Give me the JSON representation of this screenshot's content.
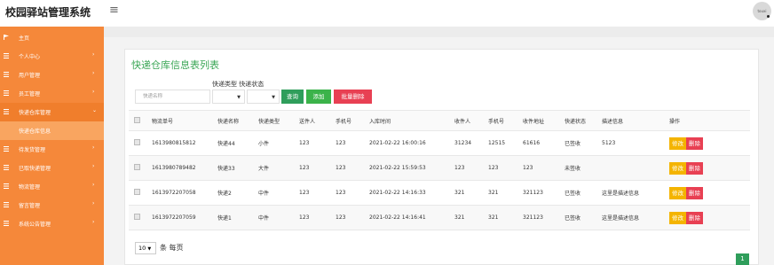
{
  "app": {
    "title": "校园驿站管理系统",
    "menu_icon": "hamburger-icon",
    "avatar_text": "touxi"
  },
  "sidebar": {
    "items": [
      {
        "label": "主页",
        "icon": "flag-icon",
        "arrow": ""
      },
      {
        "label": "个人中心",
        "icon": "grid-icon",
        "arrow": "›"
      },
      {
        "label": "用户管理",
        "icon": "grid-icon",
        "arrow": "›"
      },
      {
        "label": "员工管理",
        "icon": "grid-icon",
        "arrow": "›"
      },
      {
        "label": "快递仓库管理",
        "icon": "grid-icon",
        "arrow": "⌄"
      },
      {
        "label": "快递仓库信息",
        "icon": "",
        "arrow": ""
      },
      {
        "label": "待发货管理",
        "icon": "grid-icon",
        "arrow": "›"
      },
      {
        "label": "已取快递管理",
        "icon": "grid-icon",
        "arrow": "›"
      },
      {
        "label": "物流管理",
        "icon": "grid-icon",
        "arrow": "›"
      },
      {
        "label": "留言管理",
        "icon": "grid-icon",
        "arrow": "›"
      },
      {
        "label": "系统公告管理",
        "icon": "grid-icon",
        "arrow": "›"
      }
    ]
  },
  "main": {
    "title": "快递仓库信息表列表",
    "filters": {
      "label_type": "快递类型",
      "label_status": "快递状态",
      "search_placeholder": "快递名称",
      "type_value": "",
      "status_value": "",
      "query_label": "查询",
      "add_label": "添加",
      "batch_delete_label": "批量删除"
    },
    "table": {
      "headers": [
        "物流单号",
        "快递名称",
        "快递类型",
        "送件人",
        "手机号",
        "入库时间",
        "收件人",
        "手机号",
        "收件地址",
        "快递状态",
        "描述信息",
        "操作"
      ],
      "rows": [
        [
          "1613980815812",
          "快递44",
          "小件",
          "123",
          "123",
          "2021-02-22 16:00:16",
          "31234",
          "12515",
          "61616",
          "已签收",
          "5123"
        ],
        [
          "1613980789482",
          "快递33",
          "大件",
          "123",
          "123",
          "2021-02-22 15:59:53",
          "123",
          "123",
          "123",
          "未签收",
          ""
        ],
        [
          "1613972207058",
          "快递2",
          "中件",
          "123",
          "123",
          "2021-02-22 14:16:33",
          "321",
          "321",
          "321123",
          "已签收",
          "这里是描述信息"
        ],
        [
          "1613972207059",
          "快递1",
          "中件",
          "123",
          "123",
          "2021-02-22 14:16:41",
          "321",
          "321",
          "321123",
          "已签收",
          "这里是描述信息"
        ]
      ],
      "edit_label": "修改",
      "delete_label": "删除"
    },
    "pagination": {
      "page_size": "10",
      "page_size_suffix": "条 每页",
      "current_page": "1"
    }
  },
  "colors": {
    "sidebar": "#f5883a",
    "accent_green": "#2f9e5b",
    "danger": "#e84053",
    "warning": "#f4b400"
  }
}
